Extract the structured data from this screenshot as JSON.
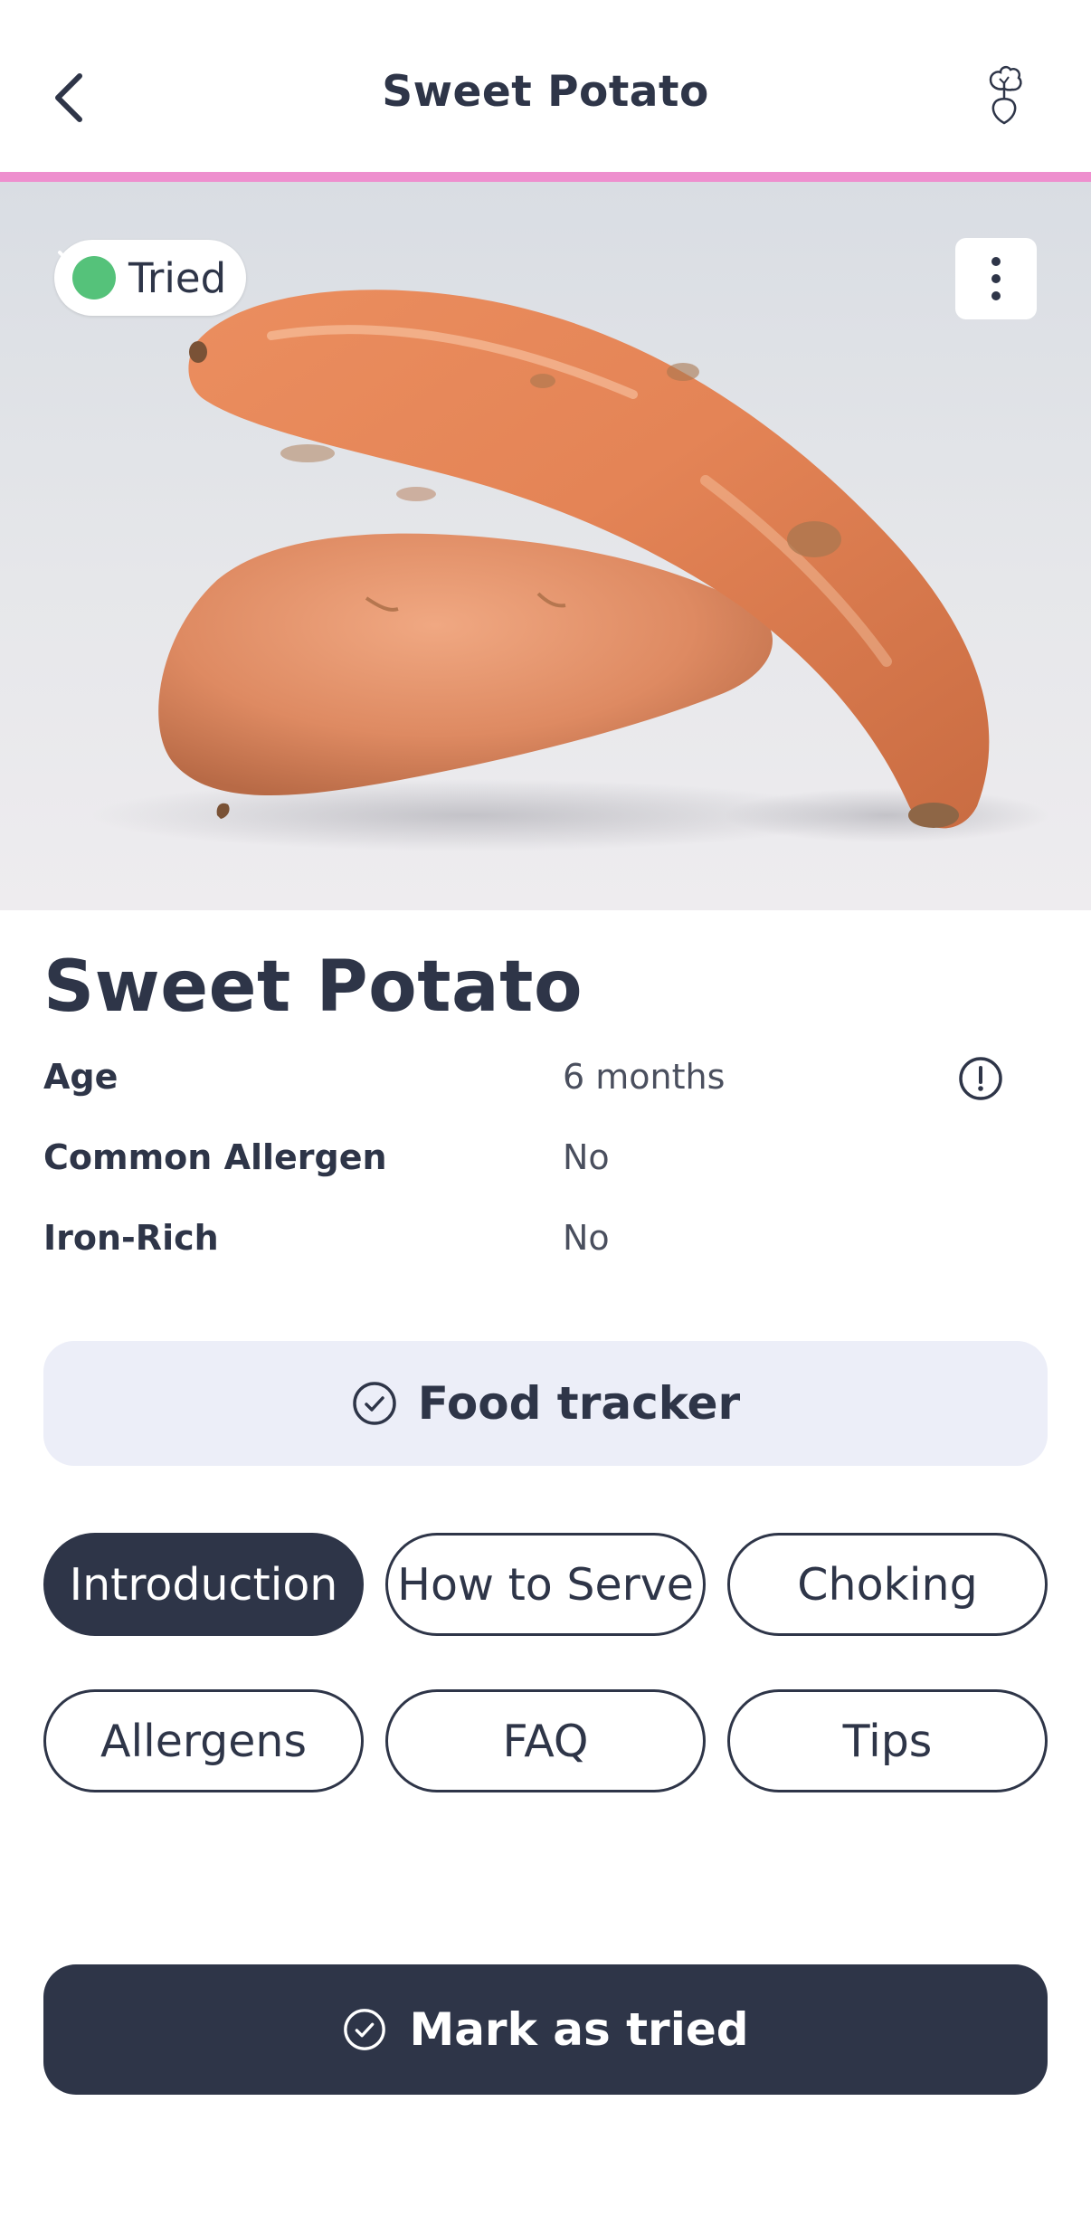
{
  "header": {
    "title": "Sweet Potato",
    "accent_color": "#ee8fce"
  },
  "hero": {
    "status_label": "Tried",
    "status_color": "#55c27a"
  },
  "food": {
    "title": "Sweet Potato",
    "attributes": [
      {
        "label": "Age",
        "value": "6 months"
      },
      {
        "label": "Common Allergen",
        "value": "No"
      },
      {
        "label": "Iron-Rich",
        "value": "No"
      }
    ]
  },
  "tracker": {
    "label": "Food tracker"
  },
  "tabs": [
    {
      "label": "Introduction",
      "active": true
    },
    {
      "label": "How to Serve",
      "active": false
    },
    {
      "label": "Choking",
      "active": false
    },
    {
      "label": "Allergens",
      "active": false
    },
    {
      "label": "FAQ",
      "active": false
    },
    {
      "label": "Tips",
      "active": false
    }
  ],
  "cta": {
    "label": "Mark as tried"
  },
  "icons": {
    "back": "chevron-left-icon",
    "header_right": "beet-icon",
    "status": "check-circle-icon",
    "menu": "more-vertical-icon",
    "info": "alert-circle-icon",
    "tracker": "check-circle-outline-icon",
    "cta": "check-circle-outline-icon"
  },
  "colors": {
    "primary": "#2e3548",
    "tracker_bg": "#eceef8"
  }
}
